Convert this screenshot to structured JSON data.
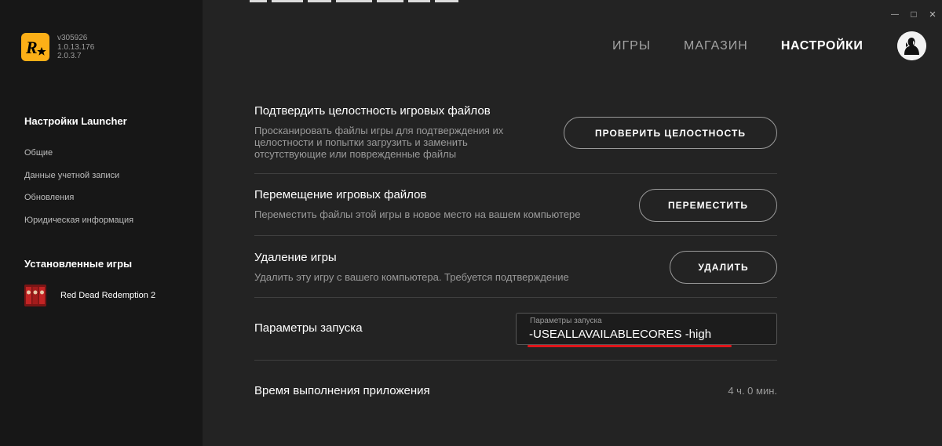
{
  "app": {
    "versions": [
      "v305926",
      "1.0.13.176",
      "2.0.3.7"
    ]
  },
  "window_controls": {
    "close": "×",
    "maximize": "□",
    "minimize": "—"
  },
  "nav": {
    "items": [
      {
        "label": "ИГРЫ",
        "active": false
      },
      {
        "label": "МАГАЗИН",
        "active": false
      },
      {
        "label": "НАСТРОЙКИ",
        "active": true
      }
    ]
  },
  "sidebar": {
    "launcher_heading": "Настройки Launcher",
    "launcher_links": [
      "Общие",
      "Данные учетной записи",
      "Обновления",
      "Юридическая информация"
    ],
    "games_heading": "Установленные игры",
    "games": [
      {
        "name": "Red Dead Redemption 2",
        "icon": "rdr2-cover-thumbnail"
      }
    ]
  },
  "settings": {
    "verify": {
      "title": "Подтвердить целостность игровых файлов",
      "description": "Просканировать файлы игры для подтверждения их целостности и попытки загрузить и заменить отсутствующие или поврежденные файлы",
      "button": "ПРОВЕРИТЬ ЦЕЛОСТНОСТЬ"
    },
    "move": {
      "title": "Перемещение игровых файлов",
      "description": "Переместить файлы этой игры в новое место на вашем компьютере",
      "button": "ПЕРЕМЕСТИТЬ"
    },
    "uninstall": {
      "title": "Удаление игры",
      "description": "Удалить эту игру с вашего компьютера. Требуется подтверждение",
      "button": "УДАЛИТЬ"
    },
    "launch": {
      "title": "Параметры запуска",
      "field_label": "Параметры запуска",
      "value": "-USEALLAVAILABLECORES -high"
    },
    "runtime": {
      "title": "Время выполнения приложения",
      "value": "4 ч. 0 мин."
    }
  },
  "colors": {
    "accent_logo": "#fcaf17",
    "highlight_underline": "#e0161b",
    "background": "#232323",
    "sidebar": "#171717"
  }
}
